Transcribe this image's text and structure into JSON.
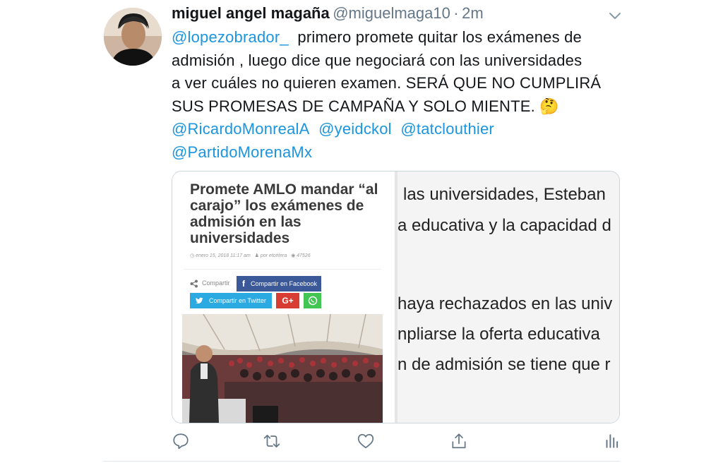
{
  "author": {
    "name": "miguel angel magaña",
    "handle": "@miguelmaga10",
    "separator": "·",
    "time": "2m"
  },
  "tweet": {
    "mention_reply": "@lopezobrador_",
    "line1_rest": "primero promete quitar los exámenes de",
    "line2": "admisión , luego dice que negociará con las universidades",
    "line3": "a ver cuáles no quieren examen. SERÁ QUE NO CUMPLIRÁ",
    "line4": "SUS PROMESAS DE CAMPAÑA Y SOLO MIENTE.",
    "emoji": "🤔",
    "mentions": [
      "@RicardoMonrealA",
      "@yeidckol",
      "@tatclouthier",
      "@PartidoMorenaMx"
    ]
  },
  "card": {
    "headline": "Promete AMLO mandar “al carajo” los exámenes de admisión en las universidades",
    "date": "enero 15, 2018 11:17 am",
    "author": "por etcétera",
    "views": "47526",
    "share_label": "Compartir",
    "facebook_label": "Compartir en Facebook",
    "twitter_label": "Compartir en Twitter",
    "gplus_label": "G+",
    "zoom_lines": [
      " las universidades, Esteban",
      "a educativa y la capacidad d",
      "haya rechazados en las univ",
      "npliarse la oferta educativa",
      "n de admisión se tiene que r"
    ]
  },
  "icons": {
    "reply": "reply-icon",
    "retweet": "retweet-icon",
    "like": "heart-icon",
    "share": "share-icon",
    "analytics": "analytics-icon",
    "caret": "chevron-down-icon"
  },
  "colors": {
    "link": "#1b95e0",
    "facebook": "#3b5998",
    "twitter": "#2ba9e1",
    "gplus": "#d73d32",
    "whatsapp": "#43c553"
  }
}
